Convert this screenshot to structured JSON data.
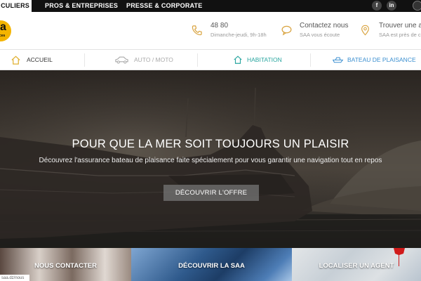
{
  "topbar": {
    "tabs": [
      {
        "label": "CULIERS"
      },
      {
        "label": "PROS & ENTREPRISES"
      },
      {
        "label": "PRESSE & CORPORATE"
      }
    ],
    "social": [
      {
        "icon": "facebook-icon",
        "glyph": "f"
      },
      {
        "icon": "linkedin-icon",
        "glyph": "in"
      }
    ],
    "globe_icon": "globe-icon"
  },
  "header": {
    "logo_text": "a",
    "logo_sub": "ces",
    "phone": {
      "icon": "phone-icon",
      "line1": "48 80",
      "line2": "Dimanche-jeudi, 9h-18h"
    },
    "contact": {
      "icon": "chat-bubble-icon",
      "line1": "Contactez nous",
      "line2": "SAA vous écoute"
    },
    "agent": {
      "icon": "location-pin-icon",
      "line1": "Trouver une ag",
      "line2": "SAA est près de ch"
    }
  },
  "nav": {
    "items": [
      {
        "label": "ACCUEIL",
        "icon": "home-icon"
      },
      {
        "label": "AUTO / MOTO",
        "icon": "car-icon"
      },
      {
        "label": "HABITATION",
        "icon": "house-icon"
      },
      {
        "label": "BATEAU DE PLAISANCE",
        "icon": "boat-icon"
      }
    ]
  },
  "hero": {
    "title": "POUR QUE LA MER SOIT TOUJOURS UN PLAISIR",
    "subtitle": "Découvrez l'assurance bateau de plaisance faite spécialement pour vous garantir une navigation tout en repos",
    "button": "DÉCOUVRIR L'OFFRE"
  },
  "cards": [
    {
      "label": "NOUS CONTACTER",
      "sticker": "saa.dz/nous"
    },
    {
      "label": "DÉCOUVRIR LA SAA"
    },
    {
      "label": "LOCALISER UN AGENT"
    }
  ],
  "colors": {
    "accent_yellow": "#f4b400",
    "nav_teal": "#2aa6a0",
    "top_bar": "#111111",
    "icon_gold": "#d9a441"
  }
}
